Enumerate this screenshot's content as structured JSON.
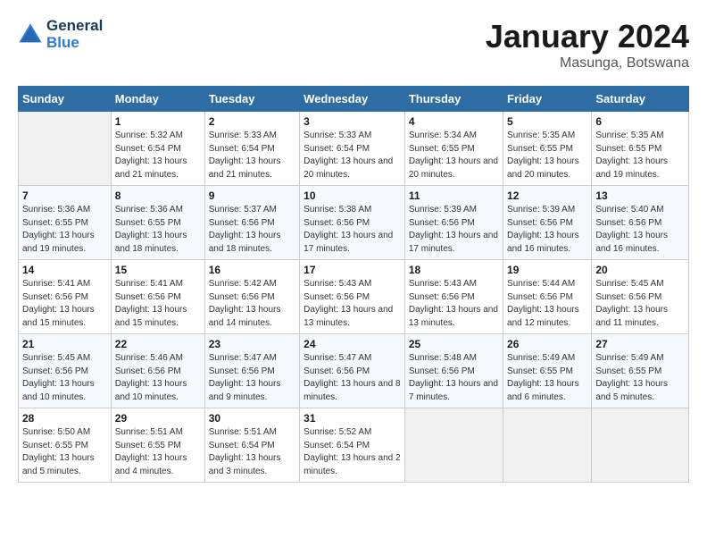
{
  "logo": {
    "line1": "General",
    "line2": "Blue"
  },
  "title": "January 2024",
  "subtitle": "Masunga, Botswana",
  "days_header": [
    "Sunday",
    "Monday",
    "Tuesday",
    "Wednesday",
    "Thursday",
    "Friday",
    "Saturday"
  ],
  "weeks": [
    [
      {
        "day": "",
        "sunrise": "",
        "sunset": "",
        "daylight": ""
      },
      {
        "day": "1",
        "sunrise": "Sunrise: 5:32 AM",
        "sunset": "Sunset: 6:54 PM",
        "daylight": "Daylight: 13 hours and 21 minutes."
      },
      {
        "day": "2",
        "sunrise": "Sunrise: 5:33 AM",
        "sunset": "Sunset: 6:54 PM",
        "daylight": "Daylight: 13 hours and 21 minutes."
      },
      {
        "day": "3",
        "sunrise": "Sunrise: 5:33 AM",
        "sunset": "Sunset: 6:54 PM",
        "daylight": "Daylight: 13 hours and 20 minutes."
      },
      {
        "day": "4",
        "sunrise": "Sunrise: 5:34 AM",
        "sunset": "Sunset: 6:55 PM",
        "daylight": "Daylight: 13 hours and 20 minutes."
      },
      {
        "day": "5",
        "sunrise": "Sunrise: 5:35 AM",
        "sunset": "Sunset: 6:55 PM",
        "daylight": "Daylight: 13 hours and 20 minutes."
      },
      {
        "day": "6",
        "sunrise": "Sunrise: 5:35 AM",
        "sunset": "Sunset: 6:55 PM",
        "daylight": "Daylight: 13 hours and 19 minutes."
      }
    ],
    [
      {
        "day": "7",
        "sunrise": "Sunrise: 5:36 AM",
        "sunset": "Sunset: 6:55 PM",
        "daylight": "Daylight: 13 hours and 19 minutes."
      },
      {
        "day": "8",
        "sunrise": "Sunrise: 5:36 AM",
        "sunset": "Sunset: 6:55 PM",
        "daylight": "Daylight: 13 hours and 18 minutes."
      },
      {
        "day": "9",
        "sunrise": "Sunrise: 5:37 AM",
        "sunset": "Sunset: 6:56 PM",
        "daylight": "Daylight: 13 hours and 18 minutes."
      },
      {
        "day": "10",
        "sunrise": "Sunrise: 5:38 AM",
        "sunset": "Sunset: 6:56 PM",
        "daylight": "Daylight: 13 hours and 17 minutes."
      },
      {
        "day": "11",
        "sunrise": "Sunrise: 5:39 AM",
        "sunset": "Sunset: 6:56 PM",
        "daylight": "Daylight: 13 hours and 17 minutes."
      },
      {
        "day": "12",
        "sunrise": "Sunrise: 5:39 AM",
        "sunset": "Sunset: 6:56 PM",
        "daylight": "Daylight: 13 hours and 16 minutes."
      },
      {
        "day": "13",
        "sunrise": "Sunrise: 5:40 AM",
        "sunset": "Sunset: 6:56 PM",
        "daylight": "Daylight: 13 hours and 16 minutes."
      }
    ],
    [
      {
        "day": "14",
        "sunrise": "Sunrise: 5:41 AM",
        "sunset": "Sunset: 6:56 PM",
        "daylight": "Daylight: 13 hours and 15 minutes."
      },
      {
        "day": "15",
        "sunrise": "Sunrise: 5:41 AM",
        "sunset": "Sunset: 6:56 PM",
        "daylight": "Daylight: 13 hours and 15 minutes."
      },
      {
        "day": "16",
        "sunrise": "Sunrise: 5:42 AM",
        "sunset": "Sunset: 6:56 PM",
        "daylight": "Daylight: 13 hours and 14 minutes."
      },
      {
        "day": "17",
        "sunrise": "Sunrise: 5:43 AM",
        "sunset": "Sunset: 6:56 PM",
        "daylight": "Daylight: 13 hours and 13 minutes."
      },
      {
        "day": "18",
        "sunrise": "Sunrise: 5:43 AM",
        "sunset": "Sunset: 6:56 PM",
        "daylight": "Daylight: 13 hours and 13 minutes."
      },
      {
        "day": "19",
        "sunrise": "Sunrise: 5:44 AM",
        "sunset": "Sunset: 6:56 PM",
        "daylight": "Daylight: 13 hours and 12 minutes."
      },
      {
        "day": "20",
        "sunrise": "Sunrise: 5:45 AM",
        "sunset": "Sunset: 6:56 PM",
        "daylight": "Daylight: 13 hours and 11 minutes."
      }
    ],
    [
      {
        "day": "21",
        "sunrise": "Sunrise: 5:45 AM",
        "sunset": "Sunset: 6:56 PM",
        "daylight": "Daylight: 13 hours and 10 minutes."
      },
      {
        "day": "22",
        "sunrise": "Sunrise: 5:46 AM",
        "sunset": "Sunset: 6:56 PM",
        "daylight": "Daylight: 13 hours and 10 minutes."
      },
      {
        "day": "23",
        "sunrise": "Sunrise: 5:47 AM",
        "sunset": "Sunset: 6:56 PM",
        "daylight": "Daylight: 13 hours and 9 minutes."
      },
      {
        "day": "24",
        "sunrise": "Sunrise: 5:47 AM",
        "sunset": "Sunset: 6:56 PM",
        "daylight": "Daylight: 13 hours and 8 minutes."
      },
      {
        "day": "25",
        "sunrise": "Sunrise: 5:48 AM",
        "sunset": "Sunset: 6:56 PM",
        "daylight": "Daylight: 13 hours and 7 minutes."
      },
      {
        "day": "26",
        "sunrise": "Sunrise: 5:49 AM",
        "sunset": "Sunset: 6:55 PM",
        "daylight": "Daylight: 13 hours and 6 minutes."
      },
      {
        "day": "27",
        "sunrise": "Sunrise: 5:49 AM",
        "sunset": "Sunset: 6:55 PM",
        "daylight": "Daylight: 13 hours and 5 minutes."
      }
    ],
    [
      {
        "day": "28",
        "sunrise": "Sunrise: 5:50 AM",
        "sunset": "Sunset: 6:55 PM",
        "daylight": "Daylight: 13 hours and 5 minutes."
      },
      {
        "day": "29",
        "sunrise": "Sunrise: 5:51 AM",
        "sunset": "Sunset: 6:55 PM",
        "daylight": "Daylight: 13 hours and 4 minutes."
      },
      {
        "day": "30",
        "sunrise": "Sunrise: 5:51 AM",
        "sunset": "Sunset: 6:54 PM",
        "daylight": "Daylight: 13 hours and 3 minutes."
      },
      {
        "day": "31",
        "sunrise": "Sunrise: 5:52 AM",
        "sunset": "Sunset: 6:54 PM",
        "daylight": "Daylight: 13 hours and 2 minutes."
      },
      {
        "day": "",
        "sunrise": "",
        "sunset": "",
        "daylight": ""
      },
      {
        "day": "",
        "sunrise": "",
        "sunset": "",
        "daylight": ""
      },
      {
        "day": "",
        "sunrise": "",
        "sunset": "",
        "daylight": ""
      }
    ]
  ]
}
